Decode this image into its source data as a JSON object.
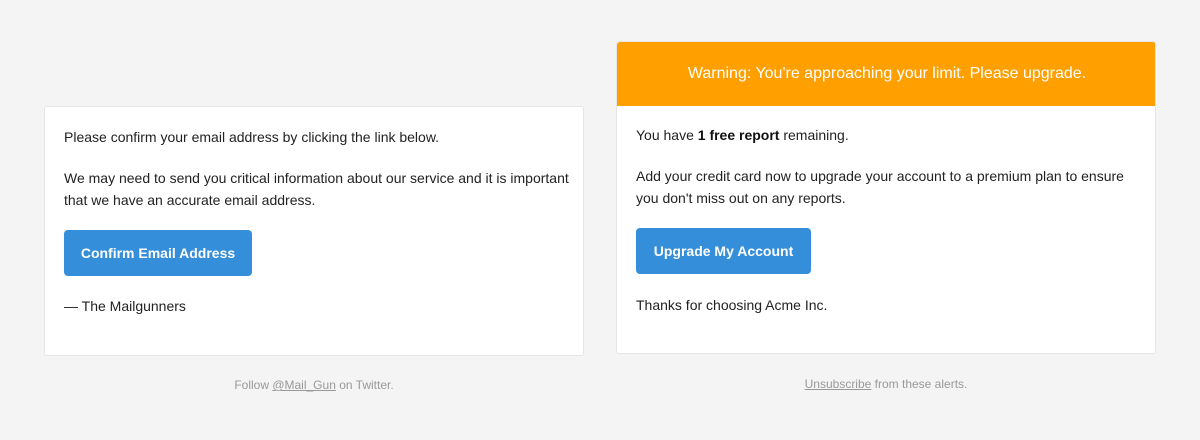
{
  "confirm_email": {
    "intro": "Please confirm your email address by clicking the link below.",
    "body_line1": "We may need to send you critical information about our service and it is important",
    "body_line2": "that we have an accurate email address.",
    "button_label": "Confirm Email Address",
    "signature": "— The Mailgunners",
    "footer_prefix": "Follow ",
    "footer_link": "@Mail_Gun",
    "footer_suffix": " on Twitter."
  },
  "alert": {
    "banner": "Warning: You're approaching your limit. Please upgrade.",
    "reports_prefix": "You have ",
    "reports_bold": "1 free report",
    "reports_suffix": " remaining.",
    "body_line1": "Add your credit card now to upgrade your account to a premium plan to ensure",
    "body_line2": "you don't miss out on any reports.",
    "button_label": "Upgrade My Account",
    "closing": "Thanks for choosing Acme Inc.",
    "footer_link": "Unsubscribe",
    "footer_suffix": " from these alerts."
  },
  "colors": {
    "button": "#348eda",
    "banner": "#ff9f00",
    "background": "#f4f4f4"
  }
}
